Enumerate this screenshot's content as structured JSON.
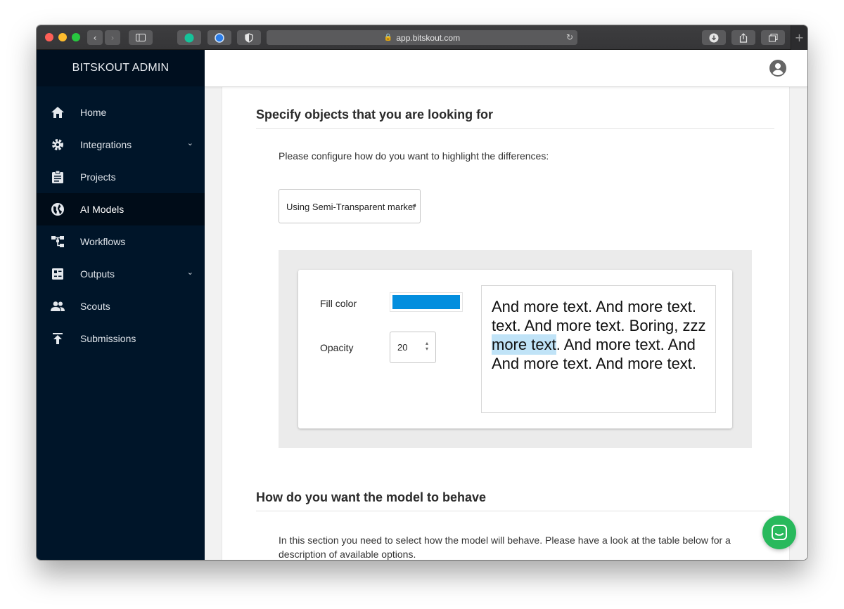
{
  "browser": {
    "url": "app.bitskout.com",
    "new_tab": "+"
  },
  "sidebar": {
    "brand": "BITSKOUT ADMIN",
    "items": [
      {
        "label": "Home",
        "icon": "home-icon"
      },
      {
        "label": "Integrations",
        "icon": "gear-icon",
        "expandable": true
      },
      {
        "label": "Projects",
        "icon": "clipboard-icon"
      },
      {
        "label": "AI Models",
        "icon": "globe-icon",
        "active": true
      },
      {
        "label": "Workflows",
        "icon": "workflow-icon"
      },
      {
        "label": "Outputs",
        "icon": "outputs-icon",
        "expandable": true
      },
      {
        "label": "Scouts",
        "icon": "people-icon"
      },
      {
        "label": "Submissions",
        "icon": "upload-icon"
      }
    ]
  },
  "main": {
    "section1": {
      "title": "Specify objects that you are looking for",
      "instruction": "Please configure how do you want to highlight the differences:",
      "highlight_mode": "Using Semi-Transparent marker",
      "preview": {
        "fill_color_label": "Fill color",
        "fill_color": "#038ede",
        "opacity_label": "Opacity",
        "opacity_value": "20",
        "sample_lines": [
          "And more text. And more text.",
          "text. And more text. Boring, zzz",
          ". And more text. And",
          "And more text. And more text."
        ],
        "highlighted_text": "more text"
      }
    },
    "section2": {
      "title": "How do you want the model to behave",
      "description_line1": "In this section you need to select how the model will behave. Please have a look at the table below for a",
      "description_line2": "description of available options."
    }
  },
  "colors": {
    "sidebar_bg": "#001529",
    "chat_button": "#28b95c"
  }
}
